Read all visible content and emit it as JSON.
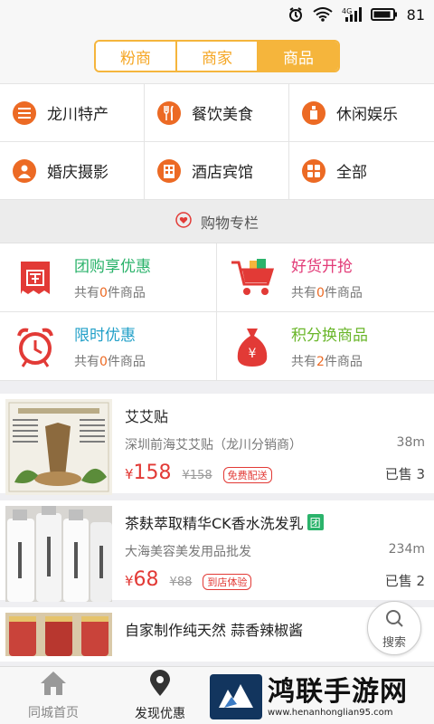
{
  "status_bar": {
    "battery": "81",
    "network": "4G"
  },
  "segments": [
    {
      "label": "粉商",
      "active": false
    },
    {
      "label": "商家",
      "active": false
    },
    {
      "label": "商品",
      "active": true
    }
  ],
  "categories": [
    {
      "label": "龙川特产",
      "icon": "list-icon"
    },
    {
      "label": "餐饮美食",
      "icon": "fork-knife-icon"
    },
    {
      "label": "休闲娱乐",
      "icon": "wine-glass-icon"
    },
    {
      "label": "婚庆摄影",
      "icon": "person-icon"
    },
    {
      "label": "酒店宾馆",
      "icon": "hotel-icon"
    },
    {
      "label": "全部",
      "icon": "grid-icon"
    }
  ],
  "section": {
    "title": "购物专栏"
  },
  "promos": [
    {
      "title": "团购享优惠",
      "sub_prefix": "共有",
      "count": "0",
      "sub_suffix": "件商品",
      "color": "#2bb36b"
    },
    {
      "title": "好货开抢",
      "sub_prefix": "共有",
      "count": "0",
      "sub_suffix": "件商品",
      "color": "#e23a77"
    },
    {
      "title": "限时优惠",
      "sub_prefix": "共有",
      "count": "0",
      "sub_suffix": "件商品",
      "color": "#22a0c8"
    },
    {
      "title": "积分换商品",
      "sub_prefix": "共有",
      "count": "2",
      "sub_suffix": "件商品",
      "color": "#6ab62a"
    }
  ],
  "products": [
    {
      "title": "艾艾贴",
      "shop": "深圳前海艾艾贴（龙川分销商）",
      "distance": "38m",
      "currency": "¥",
      "price": "158",
      "old_price": "¥158",
      "tag": "免费配送",
      "sold": "已售 3"
    },
    {
      "title": "茶麸萃取精华CK香水洗发乳",
      "badge": "团",
      "shop": "大海美容美发用品批发",
      "distance": "234m",
      "currency": "¥",
      "price": "68",
      "old_price": "¥88",
      "tag": "到店体验",
      "sold": "已售 2"
    },
    {
      "title": "自家制作纯天然  蒜香辣椒酱"
    }
  ],
  "search_button": {
    "label": "搜索"
  },
  "tabs": [
    {
      "label": "同城首页",
      "active": false
    },
    {
      "label": "发现优惠",
      "active": true
    }
  ],
  "watermark": {
    "title": "鸿联手游网",
    "url": "www.henanhonglian95.com"
  },
  "colors": {
    "accent": "#f5b53c",
    "category_icon": "#ec6a24",
    "price": "#e23a36"
  }
}
